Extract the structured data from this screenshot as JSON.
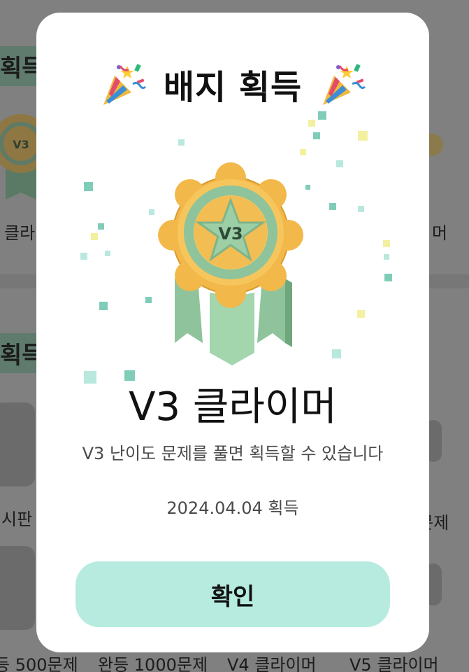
{
  "background": {
    "tag_top": "획득",
    "tag_mid": "획득",
    "label_left_top": "클라",
    "label_right_top": "머",
    "label_left_mid": "시판",
    "label_right_mid": "문제",
    "bottom_labels": [
      "등 500문제",
      "완등 1000문제",
      "V4 클라이머",
      "V5 클라이머"
    ]
  },
  "modal": {
    "title": "배지 획득",
    "badge_grade": "V3",
    "badge_name": "V3 클라이머",
    "description": "V3 난이도 문제를 풀면 획득할 수 있습니다",
    "acquired_date": "2024.04.04 획득",
    "confirm_label": "확인"
  },
  "colors": {
    "overlay": "#7e7e7e",
    "modal_bg": "#ffffff",
    "button_bg": "#b7ebe0",
    "badge_gold": "#f2b84a",
    "badge_mint": "#9ccfa6",
    "confetti_teal": "#7fcdb8",
    "confetti_yellow": "#f3f0a0"
  },
  "icons": {
    "title_left": "party-popper-icon",
    "title_right": "party-popper-icon",
    "badge": "v3-climber-medal-icon"
  }
}
